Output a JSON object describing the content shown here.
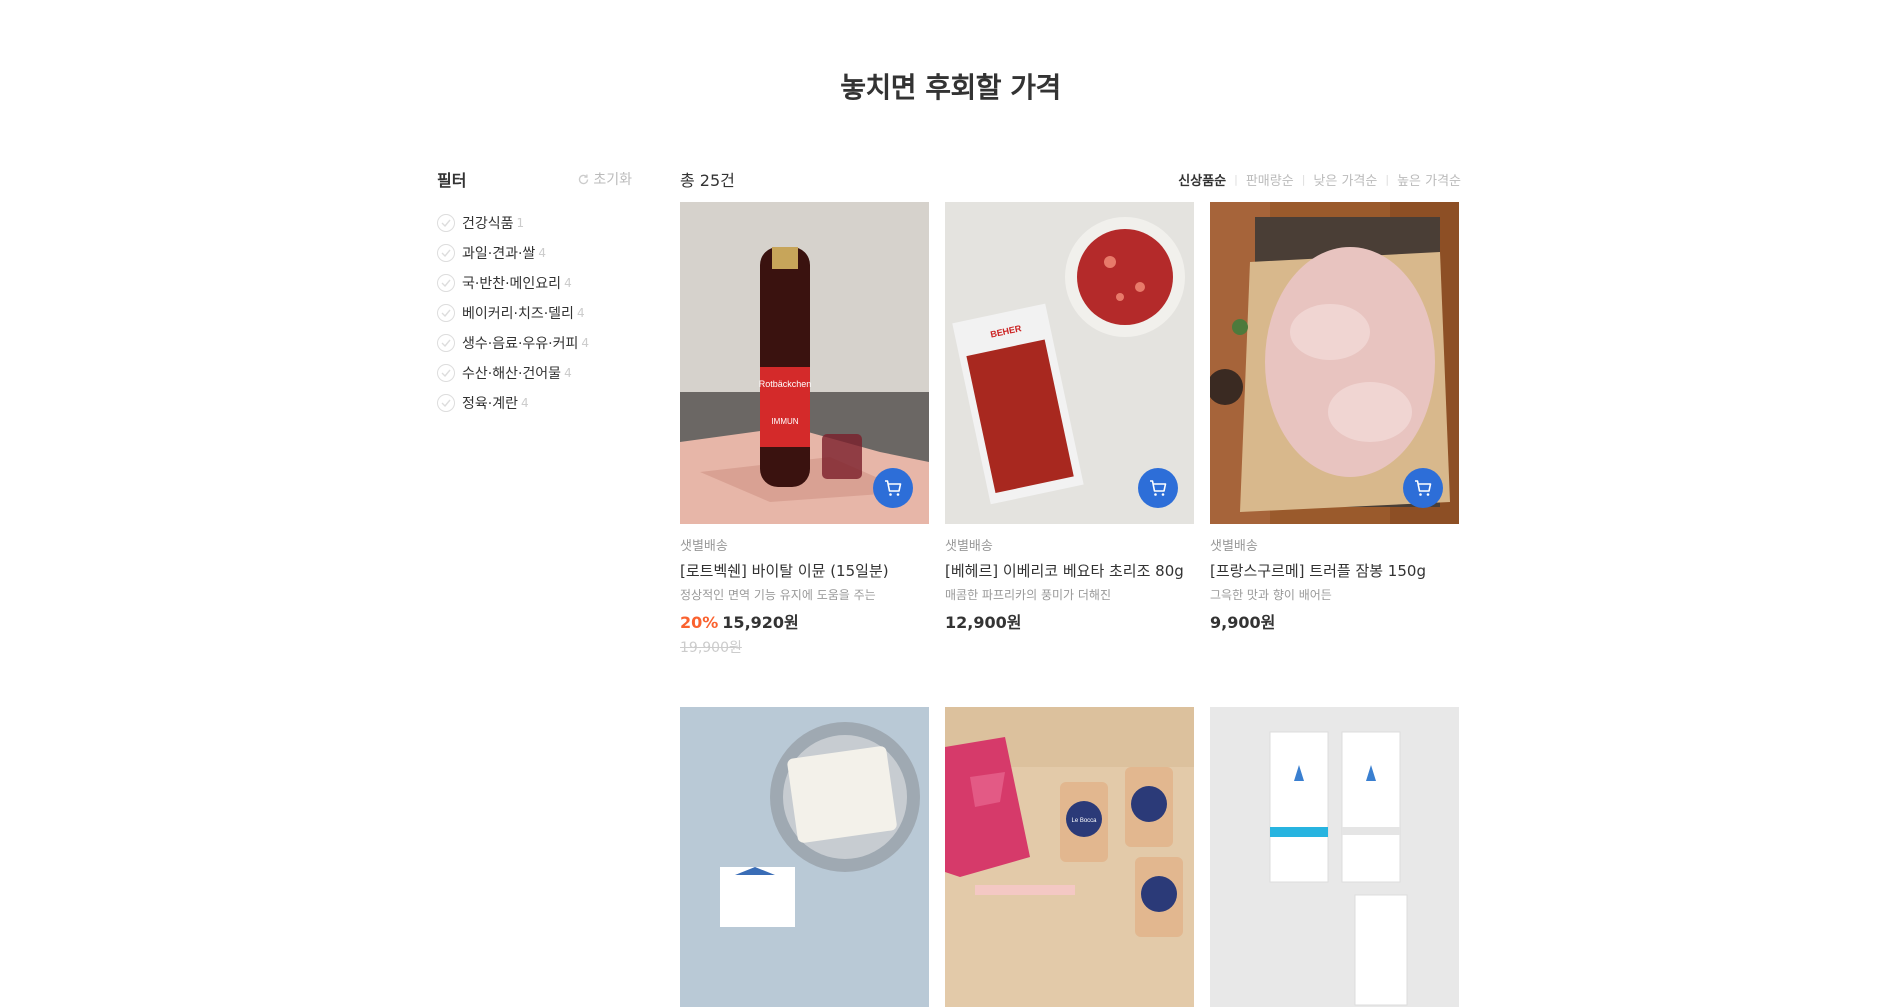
{
  "page": {
    "title": "놓치면 후회할 가격"
  },
  "filter": {
    "title": "필터",
    "reset_label": "초기화",
    "categories": [
      {
        "label": "건강식품",
        "count": "1"
      },
      {
        "label": "과일·견과·쌀",
        "count": "4"
      },
      {
        "label": "국·반찬·메인요리",
        "count": "4"
      },
      {
        "label": "베이커리·치즈·델리",
        "count": "4"
      },
      {
        "label": "생수·음료·우유·커피",
        "count": "4"
      },
      {
        "label": "수산·해산·건어물",
        "count": "4"
      },
      {
        "label": "정육·계란",
        "count": "4"
      }
    ]
  },
  "listing": {
    "total": "총 25건",
    "sorts": [
      "신상품순",
      "판매량순",
      "낮은 가격순",
      "높은 가격순"
    ],
    "active_sort": "신상품순"
  },
  "products": [
    {
      "shipping": "샛별배송",
      "name": "[로트벡쉔] 바이탈 이뮨 (15일분)",
      "desc": "정상적인 면역 기능 유지에 도움을 주는",
      "discount": "20%",
      "price": "15,920원",
      "original_price": "19,900원"
    },
    {
      "shipping": "샛별배송",
      "name": "[베헤르] 이베리코 베요타 초리조 80g",
      "desc": "매콤한 파프리카의 풍미가 더해진",
      "discount": "",
      "price": "12,900원",
      "original_price": ""
    },
    {
      "shipping": "샛별배송",
      "name": "[프랑스구르메] 트러플 잠봉 150g",
      "desc": "그윽한 맛과 향이 배어든",
      "discount": "",
      "price": "9,900원",
      "original_price": ""
    }
  ],
  "product_images": {
    "bottle_label": "Rotbäckchen",
    "bottle_sub": "IMMUN",
    "package_label": "BEHER",
    "jar_label": "Le Bocca"
  },
  "colors": {
    "accent": "#2d6ed8",
    "discount": "#fa622f"
  }
}
